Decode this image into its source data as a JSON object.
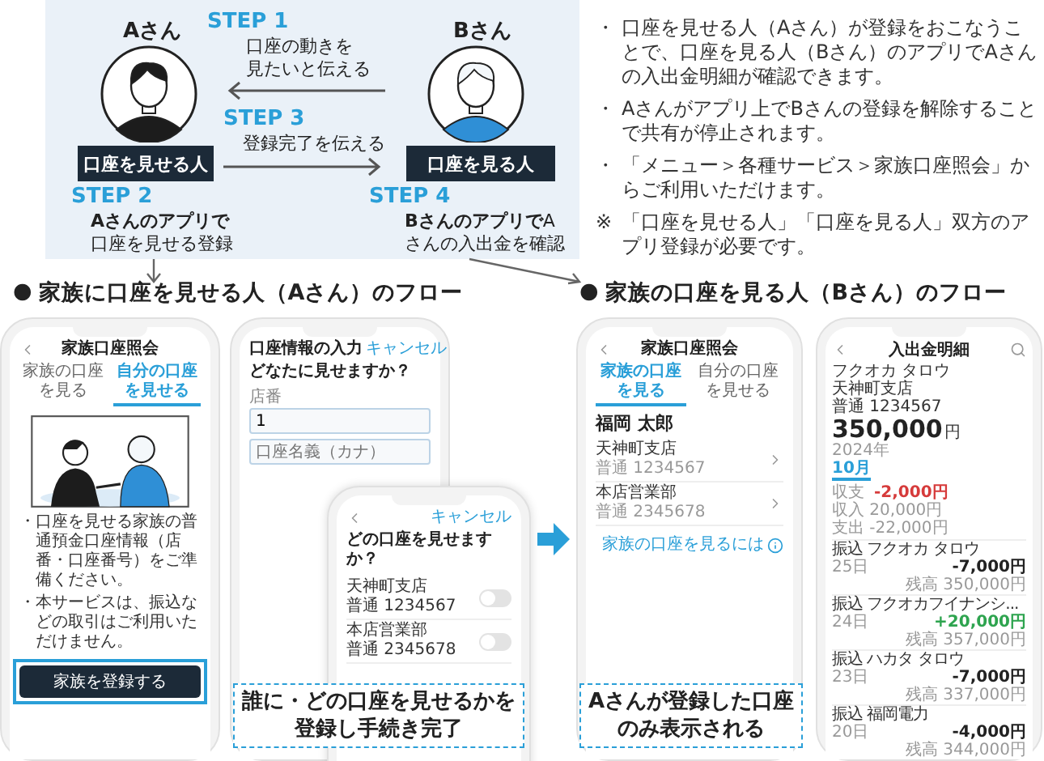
{
  "diagram": {
    "people": [
      {
        "name": "Aさん",
        "role": "口座を見せる人",
        "kind": "dark"
      },
      {
        "name": "Bさん",
        "role": "口座を見る人",
        "kind": "light"
      }
    ],
    "steps": [
      {
        "label": "STEP 1",
        "lines": [
          {
            "text": "口座の動きを",
            "bold": false
          },
          {
            "text": "見たいと伝える",
            "bold": false
          }
        ]
      },
      {
        "label": "STEP 3",
        "lines": [
          {
            "text": "登録完了を伝える",
            "bold": false
          }
        ]
      },
      {
        "label": "STEP 2",
        "lines": [
          {
            "text": "Aさんのアプリで",
            "bold": true
          },
          {
            "text": "口座を見せる登録",
            "bold": false
          }
        ]
      },
      {
        "label": "STEP 4",
        "lines": [
          {
            "text": "**Bさんのアプリで**A",
            "bold": false
          },
          {
            "text": "さんの入出金を確認",
            "bold": false
          }
        ]
      }
    ]
  },
  "notes": [
    {
      "mark": "・",
      "text": "口座を見せる人（Aさん）が登録をおこなうことで、口座を見る人（Bさん）のアプリでAさんの入出金明細が確認できます。"
    },
    {
      "mark": "・",
      "text": "Aさんがアプリ上でBさんの登録を解除することで共有が停止されます。"
    },
    {
      "mark": "・",
      "text": "「メニュー＞各種サービス＞家族口座照会」からご利用いただけます。"
    },
    {
      "mark": "※",
      "text": "「口座を見せる人」「口座を見る人」双方のアプリ登録が必要です。"
    }
  ],
  "flows": [
    {
      "marker": "●",
      "title": "家族に口座を見せる人（Aさん）のフロー",
      "caption": "誰に・どの口座を見せるかを登録し手続き完了",
      "register_screen": {
        "title": "家族口座照会",
        "tabs": [
          {
            "label": "家族の口座を見る",
            "selected": false
          },
          {
            "label": "自分の口座を見せる",
            "selected": true
          }
        ],
        "notes": [
          {
            "mark": "・",
            "text": "口座を見せる家族の普通預金口座情報（店番・口座番号）をご準備ください。"
          },
          {
            "mark": "・",
            "text": "本サービスは、振込などの取引はご利用いただけません。"
          }
        ],
        "button": "家族を登録する"
      },
      "input_screen": {
        "title": "口座情報の入力",
        "cancel": "キャンセル",
        "question": "どなたに見せますか？",
        "fields": [
          {
            "label": "店番",
            "value": "1"
          },
          {
            "placeholder": "口座名義（カナ）"
          }
        ]
      },
      "select_screen": {
        "cancel": "キャンセル",
        "question": "どの口座を見せますか？",
        "accounts": [
          {
            "branch": "天神町支店",
            "number": "普通 1234567",
            "on": false
          },
          {
            "branch": "本店営業部",
            "number": "普通 2345678",
            "on": false
          }
        ]
      }
    },
    {
      "marker": "●",
      "title": "家族の口座を見る人（Bさん）のフロー",
      "caption": "Aさんが登録した口座のみ表示される",
      "family_screen": {
        "title": "家族口座照会",
        "tabs": [
          {
            "label": "家族の口座を見る",
            "selected": true
          },
          {
            "label": "自分の口座を見せる",
            "selected": false
          }
        ],
        "name": "福岡 太郎",
        "accounts": [
          {
            "branch": "天神町支店",
            "number": "普通 1234567"
          },
          {
            "branch": "本店営業部",
            "number": "普通 2345678"
          }
        ],
        "link": "家族の口座を見るには"
      },
      "statement_screen": {
        "title": "入出金明細",
        "holder": "フクオカ タロウ",
        "branch": "天神町支店",
        "account": "普通 1234567",
        "balance": "350,000",
        "currency": "円",
        "year": "2024年",
        "month": "10月",
        "net_label": "収支",
        "net": "-2,000円",
        "income": "収入 20,000円",
        "expense": "支出 -22,000円",
        "transactions": [
          {
            "name": "振込 フクオカ タロウ",
            "date": "25日",
            "amount": "-7,000円",
            "kind": "debit",
            "balance": "残高 350,000円"
          },
          {
            "name": "振込 フクオカフイナンシ...",
            "date": "24日",
            "amount": "+20,000円",
            "kind": "credit",
            "balance": "残高 357,000円"
          },
          {
            "name": "振込 ハカタ タロウ",
            "date": "23日",
            "amount": "-7,000円",
            "kind": "debit",
            "balance": "残高 337,000円"
          },
          {
            "name": "振込 福岡電力",
            "date": "20日",
            "amount": "-4,000円",
            "kind": "debit",
            "balance": "残高 344,000円"
          }
        ]
      }
    }
  ]
}
